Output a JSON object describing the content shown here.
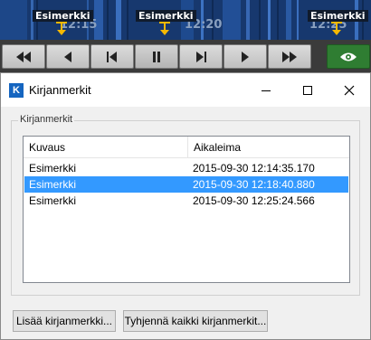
{
  "timeline": {
    "times": [
      "12:15",
      "12:20",
      "12:25"
    ],
    "markers": [
      {
        "label": "Esimerkki"
      },
      {
        "label": "Esimerkki"
      },
      {
        "label": "Esimerkki"
      }
    ],
    "marker_color": "#f5b800"
  },
  "controls": {
    "buttons": [
      {
        "icon": "fast-rewind-icon"
      },
      {
        "icon": "step-back-icon"
      },
      {
        "icon": "skip-previous-icon"
      },
      {
        "icon": "pause-icon",
        "active": true
      },
      {
        "icon": "skip-next-icon"
      },
      {
        "icon": "play-icon"
      },
      {
        "icon": "fast-forward-icon"
      }
    ],
    "view_button": {
      "icon": "eye-icon",
      "color": "#2f7d32"
    }
  },
  "dialog": {
    "title": "Kirjanmerkit",
    "app_icon_letter": "K",
    "app_icon_color": "#1565c0",
    "group_label": "Kirjanmerkit",
    "columns": [
      "Kuvaus",
      "Aikaleima"
    ],
    "rows": [
      {
        "description": "Esimerkki",
        "timestamp": "2015-09-30 12:14:35.170",
        "selected": false
      },
      {
        "description": "Esimerkki",
        "timestamp": "2015-09-30 12:18:40.880",
        "selected": true
      },
      {
        "description": "Esimerkki",
        "timestamp": "2015-09-30 12:25:24.566",
        "selected": false
      }
    ],
    "selection_color": "#3399ff",
    "add_button": "Lisää kirjanmerkki...",
    "clear_button": "Tyhjennä kaikki kirjanmerkit..."
  }
}
